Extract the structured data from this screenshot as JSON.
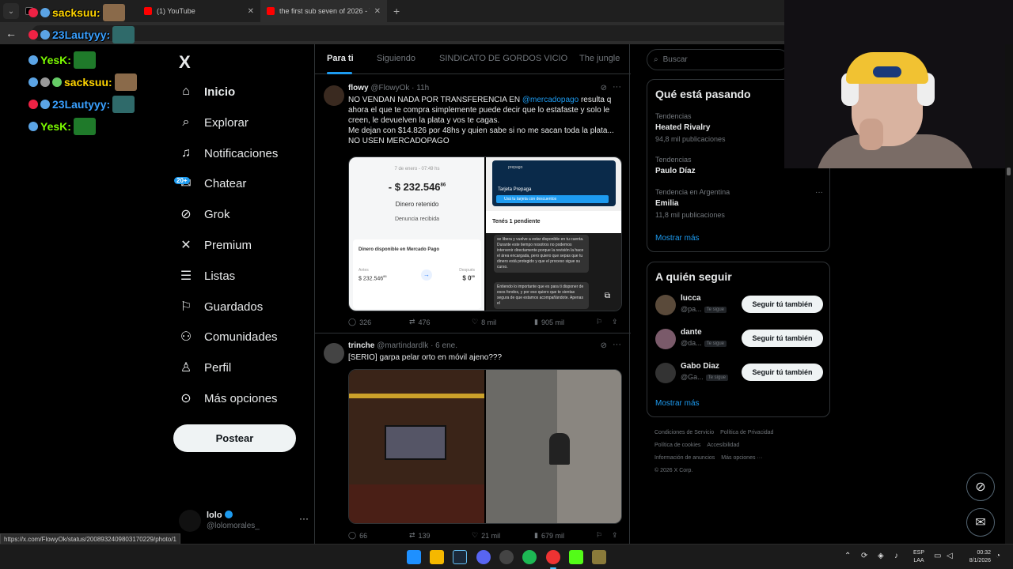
{
  "browser": {
    "tabs": [
      {
        "title": "",
        "active": false
      },
      {
        "title": "(1) YouTube",
        "active": false
      },
      {
        "title": "the first sub seven of 2026 - Yo",
        "active": true
      }
    ],
    "new_tab": "+",
    "back": "←"
  },
  "chat": [
    {
      "name": "sacksuu:",
      "color": "#ffd400"
    },
    {
      "name": "YesK:",
      "color": "#7cfc00"
    },
    {
      "name": "sacksuu:",
      "color": "#ffd400"
    },
    {
      "name": "23Lautyyy:",
      "color": "#39a0ff"
    },
    {
      "name": "YesK:",
      "color": "#7cfc00"
    }
  ],
  "chat_top": {
    "name": "23Lautyyy:"
  },
  "nav": {
    "logo": "X",
    "items": [
      {
        "label": "Inicio",
        "icon": "home-icon"
      },
      {
        "label": "Explorar",
        "icon": "search-icon"
      },
      {
        "label": "Notificaciones",
        "icon": "bell-icon"
      },
      {
        "label": "Chatear",
        "icon": "mail-icon",
        "badge": "20+"
      },
      {
        "label": "Grok",
        "icon": "grok-icon"
      },
      {
        "label": "Premium",
        "icon": "x-icon"
      },
      {
        "label": "Listas",
        "icon": "list-icon"
      },
      {
        "label": "Guardados",
        "icon": "bookmark-icon"
      },
      {
        "label": "Comunidades",
        "icon": "people-icon"
      },
      {
        "label": "Perfil",
        "icon": "person-icon"
      },
      {
        "label": "Más opciones",
        "icon": "more-icon"
      }
    ],
    "post_label": "Postear",
    "profile": {
      "name": "lolo",
      "handle": "@lolomorales_",
      "more": "···"
    }
  },
  "feed": {
    "tabs": [
      "Para ti",
      "Siguiendo",
      "SINDICATO DE GORDOS VICIO",
      "The jungle"
    ],
    "tweets": [
      {
        "name": "flowy",
        "handle": "@FlowyOk · 11h",
        "text_1": "NO VENDAN NADA POR TRANSFERENCIA EN ",
        "mention": "@mercadopago",
        "text_2": " resulta q ahora el que te compra simplemente puede decir que lo estafaste y solo le creen, le devuelven la plata y vos te cagas.",
        "text_3": "Me dejan con $14.826 por 48hs y quien sabe si no me sacan toda la plata... NO USEN MERCADOPAGO",
        "media": {
          "date": "7 de enero - 07:49 hs",
          "amount": "- $ 232.546",
          "amount_cents": "86",
          "status": "Dinero retenido",
          "denuncia": "Denuncia recibida",
          "card_title": "Dinero disponible en Mercado Pago",
          "antes_label": "Antes",
          "antes_value": "$ 232.546",
          "antes_cents": "86",
          "despues_label": "Después",
          "despues_value": "$ 0",
          "despues_cents": "00",
          "card_brand": "prepago",
          "card_type": "Tarjeta Prepaga",
          "card_bar": "Usá tu tarjeta con descuentos",
          "pending": "Tenés 1 pendiente",
          "bubble_1": "se libera y vuelve a estar disponible en tu cuenta. Durante este tiempo nosotros no podemos intervenir directamente porque la revisión la hace el área encargada, pero quiero que sepas que tu dinero está protegido y que el proceso sigue su curso.",
          "bubble_2": "Entiendo lo importante que es para ti disponer de esos fondos, y por eso quiero que te sientas segura de que estamos acompañándote. Apenas el"
        },
        "replies": "326",
        "reposts": "476",
        "likes": "8 mil",
        "views": "905 mil"
      },
      {
        "name": "trinche",
        "handle": "@martindardlk · 6 ene.",
        "text_1": "[SERIO] garpa pelar orto en móvil ajeno???",
        "replies": "66",
        "reposts": "139",
        "likes": "21 mil",
        "views": "679 mil"
      }
    ]
  },
  "right": {
    "search_placeholder": "Buscar",
    "trends_title": "Qué está pasando",
    "trends": [
      {
        "context": "Tendencias",
        "name": "Heated Rivalry",
        "count": "94,8 mil publicaciones"
      },
      {
        "context": "Tendencias",
        "name": "Paulo Díaz",
        "count": ""
      },
      {
        "context": "Tendencia en Argentina",
        "name": "Emilia",
        "count": "11,8 mil publicaciones"
      }
    ],
    "trends_more": "Mostrar más",
    "follow_title": "A quién seguir",
    "follow": [
      {
        "name": "lucca",
        "handle": "@pa...",
        "tag": "Te sigue",
        "button": "Seguir tú también"
      },
      {
        "name": "dante",
        "handle": "@da...",
        "tag": "Te sigue",
        "button": "Seguir tú también"
      },
      {
        "name": "Gabo Diaz",
        "handle": "@Ga...",
        "tag": "Te sigue",
        "button": "Seguir tú también"
      }
    ],
    "follow_more": "Mostrar más",
    "footer": [
      "Condiciones de Servicio",
      "Política de Privacidad",
      "Política de cookies",
      "Accesibilidad",
      "Información de anuncios",
      "Más opciones ···",
      "© 2026 X Corp."
    ]
  },
  "status_url": "https://x.com/FlowyOk/status/2008932409803170229/photo/1",
  "taskbar": {
    "lang_1": "ESP",
    "lang_2": "LAA",
    "time": "00:32",
    "date": "8/1/2026"
  },
  "colors": {
    "accent": "#1d9bf0",
    "background": "#000000",
    "border": "#2f3336"
  }
}
